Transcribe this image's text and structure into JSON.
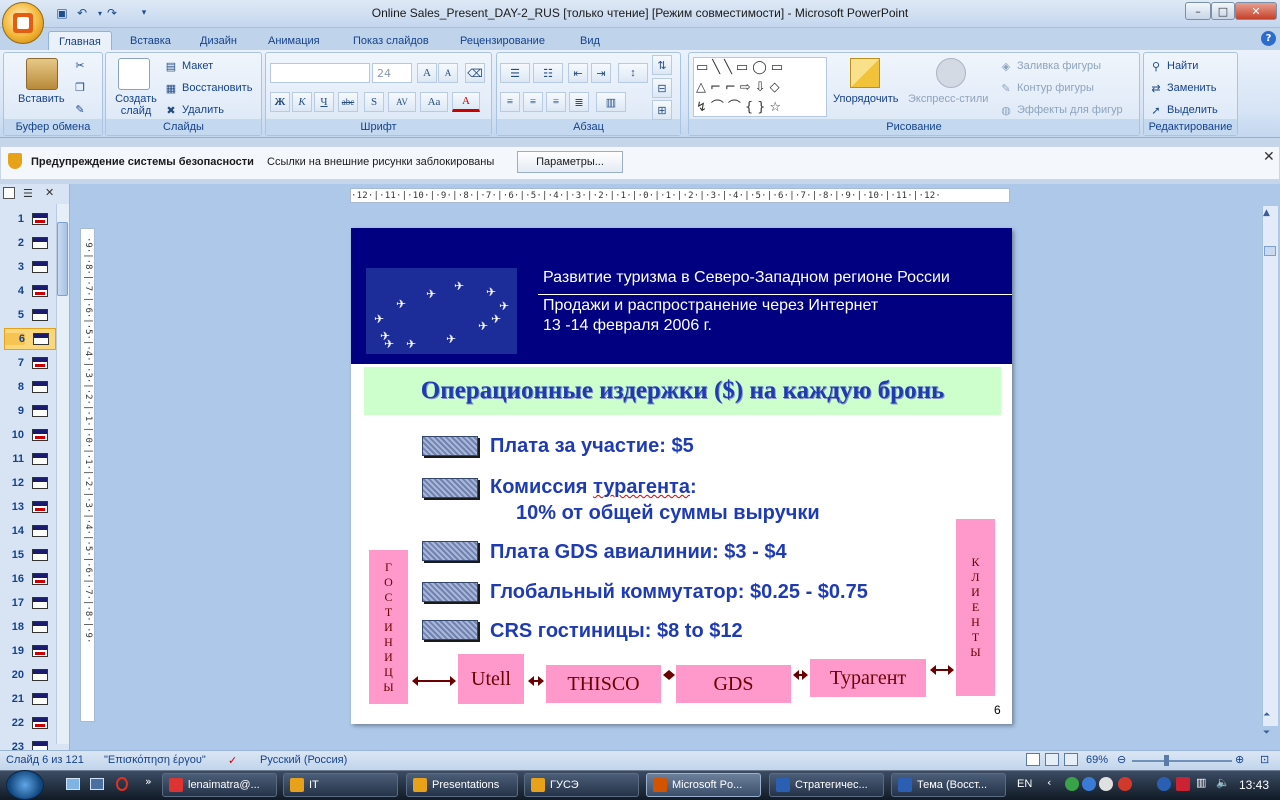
{
  "window": {
    "title": "Online Sales_Present_DAY-2_RUS [только чтение] [Режим совместимости] - Microsoft PowerPoint",
    "min": "–",
    "max": "□",
    "close": "✕"
  },
  "tabs": [
    "Главная",
    "Вставка",
    "Дизайн",
    "Анимация",
    "Показ слайдов",
    "Рецензирование",
    "Вид"
  ],
  "ribbon": {
    "clipboard": {
      "label": "Буфер обмена",
      "paste": "Вставить"
    },
    "slides": {
      "label": "Слайды",
      "create": "Создать слайд",
      "layout": "Макет",
      "reset": "Восстановить",
      "delete": "Удалить"
    },
    "font": {
      "label": "Шрифт",
      "size": "24",
      "bold": "Ж",
      "italic": "К",
      "underline": "Ч",
      "strike": "abc",
      "shadow": "S",
      "spacing": "AV",
      "case": "Aa",
      "color": "A",
      "grow": "A",
      "shrink": "A"
    },
    "paragraph": {
      "label": "Абзац"
    },
    "drawing": {
      "label": "Рисование",
      "arrange": "Упорядочить",
      "quickstyles": "Экспресс-стили",
      "fill": "Заливка фигуры",
      "outline": "Контур фигуры",
      "effects": "Эффекты для фигур"
    },
    "editing": {
      "label": "Редактирование",
      "find": "Найти",
      "replace": "Заменить",
      "select": "Выделить"
    }
  },
  "security": {
    "title": "Предупреждение системы безопасности",
    "message": "Ссылки на внешние рисунки заблокированы",
    "button": "Параметры..."
  },
  "thumbnails": [
    "1",
    "2",
    "3",
    "4",
    "5",
    "6",
    "7",
    "8",
    "9",
    "10",
    "11",
    "12",
    "13",
    "14",
    "15",
    "16",
    "17",
    "18",
    "19",
    "20",
    "21",
    "22",
    "23"
  ],
  "ruler": {
    "horizontal": "·12·|·11·|·10·|·9·|·8·|·7·|·6·|·5·|·4·|·3·|·2·|·1·|·0·|·1·|·2·|·3·|·4·|·5·|·6·|·7·|·8·|·9·|·10·|·11·|·12·",
    "vertical": "·9·|·8·|·7·|·6·|·5·|·4·|·3·|·2·|·1·|·0·|·1·|·2·|·3·|·4·|·5·|·6·|·7·|·8·|·9·"
  },
  "slide": {
    "banner_line1": "Развитие туризма в Северо-Западном регионе России",
    "banner_line2": "Продажи и распространение через Интернет",
    "banner_line3": "13 -14 февраля 2006 г.",
    "heading": "Операционные издержки ($) на каждую бронь",
    "bullets": {
      "b1": "Плата за участие:  $5",
      "b2_a": "Комиссия ",
      "b2_b": "турагента",
      "b2_c": ":",
      "b2_line2": "10% от общей суммы выручки",
      "b3": "Плата GDS авиалинии: $3 - $4",
      "b4": "Глобальный коммутатор:  $0.25 - $0.75",
      "b5": "CRS гостиницы: $8 to $12"
    },
    "hotels_letters": [
      "Г",
      "О",
      "С",
      "Т",
      "И",
      "Н",
      "И",
      "Ц",
      "Ы"
    ],
    "clients_letters": [
      "К",
      "Л",
      "И",
      "Е",
      "Н",
      "Т",
      "Ы"
    ],
    "chain": [
      "Utell",
      "THISCO",
      "GDS",
      "Турагент"
    ],
    "page": "6"
  },
  "status": {
    "slide": "Слайд 6 из 121",
    "theme": "\"Επισκόπηση έργου\"",
    "language": "Русский (Россия)",
    "zoom": "69%"
  },
  "taskbar": {
    "tasks": [
      "lenaimatra@...",
      "IT",
      "Presentations",
      "ГУСЭ",
      "Microsoft Po...",
      "Стратегичес...",
      "Тема (Восст..."
    ],
    "lang": "EN",
    "clock": "13:43"
  },
  "colors": {
    "banner": "#000080",
    "heading_bg": "#ccffcc",
    "text_blue": "#1f3bb3",
    "pink": "#ff99cc",
    "dark_red": "#6b0000"
  }
}
